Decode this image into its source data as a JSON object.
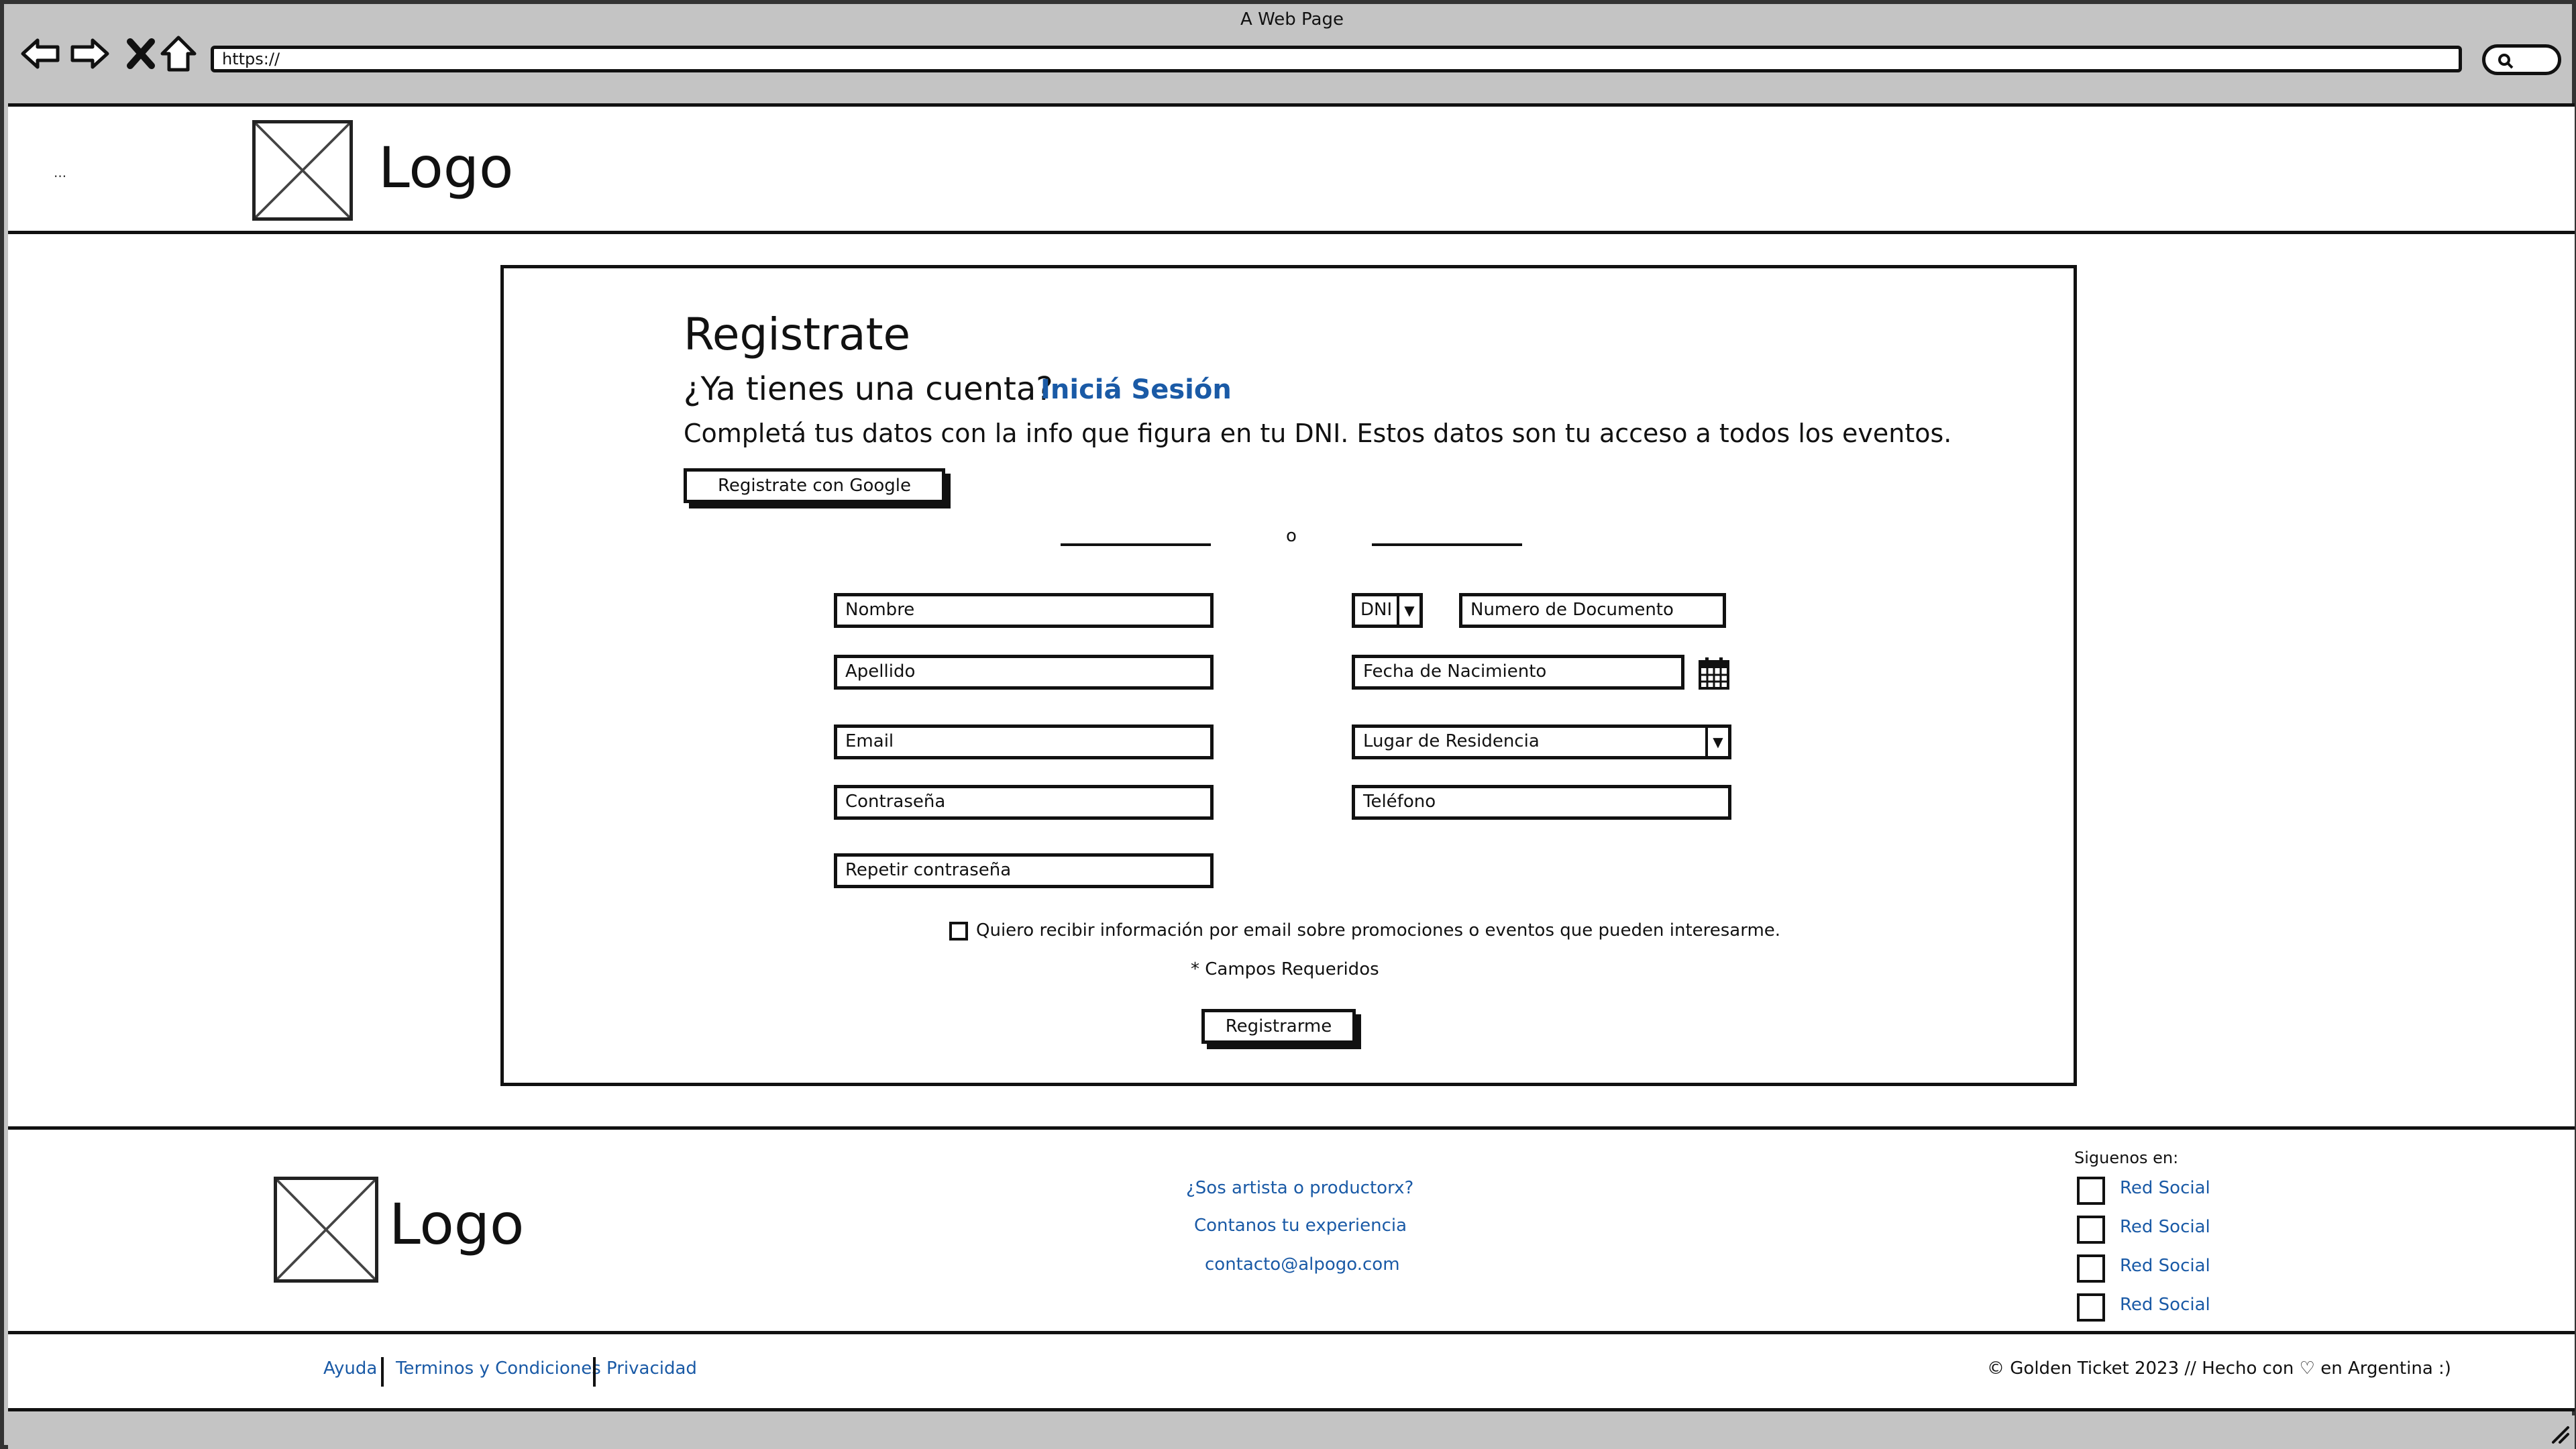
{
  "window": {
    "title": "A Web Page"
  },
  "toolbar": {
    "url": "https://",
    "icons": [
      "back-arrow-icon",
      "forward-arrow-icon",
      "close-icon",
      "home-icon",
      "search-icon"
    ]
  },
  "header": {
    "menu_text": "...",
    "logo_text": "Logo"
  },
  "register": {
    "title": "Registrate",
    "have_account": "¿Ya tienes una cuenta?",
    "login_link": "Iniciá Sesión",
    "lead": "Completá tus datos con la info que figura en tu DNI. Estos datos son tu acceso a todos los eventos.",
    "google_button": "Registrate con Google",
    "or_text": "o",
    "fields": {
      "nombre": "Nombre",
      "apellido": "Apellido",
      "email": "Email",
      "password": "Contraseña",
      "repeat_password": "Repetir contraseña",
      "doc_type": "DNI",
      "doc_number": "Numero de Documento",
      "birth_date": "Fecha de Nacimiento",
      "residence": "Lugar de Residencia",
      "phone": "Teléfono"
    },
    "newsletter_label": "Quiero recibir información por email sobre promociones o eventos que pueden interesarme.",
    "required_note": "* Campos Requeridos",
    "submit_button": "Registrarme"
  },
  "footer": {
    "logo_text": "Logo",
    "links": [
      "¿Sos artista o productorx?",
      "Contanos tu experiencia",
      "contacto@alpogo.com"
    ],
    "social_title": "Siguenos en:",
    "social_links": [
      "Red Social",
      "Red Social",
      "Red Social",
      "Red Social"
    ],
    "bottom_links": [
      "Ayuda",
      "Terminos y Condiciones",
      "Privacidad"
    ],
    "copyright": "© Golden Ticket 2023 // Hecho con ♡ en Argentina :)"
  },
  "colors": {
    "link": "#1a5aa6",
    "chrome": "#c4c4c4",
    "ink": "#111111"
  }
}
